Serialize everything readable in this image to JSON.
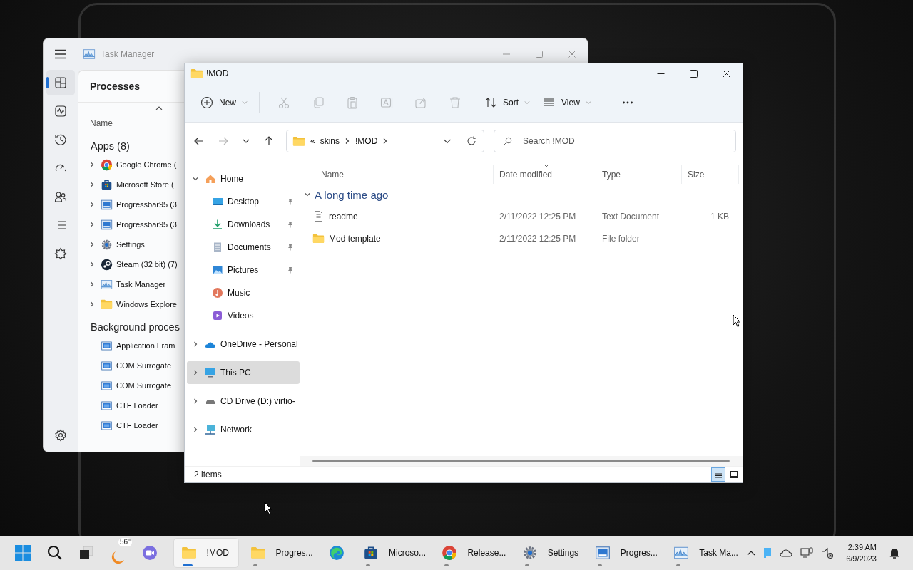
{
  "task_manager": {
    "title": "Task Manager",
    "nav": [
      {
        "selected": true
      },
      {
        "selected": false
      },
      {
        "selected": false
      },
      {
        "selected": false
      },
      {
        "selected": false
      },
      {
        "selected": false
      },
      {
        "selected": false
      }
    ],
    "page_title": "Processes",
    "columns": [
      "Name"
    ],
    "groups": [
      {
        "title": "Apps (8)",
        "items": [
          {
            "name": "Google Chrome (",
            "expandable": true
          },
          {
            "name": "Microsoft Store (",
            "expandable": true
          },
          {
            "name": "Progressbar95 (3",
            "expandable": true
          },
          {
            "name": "Progressbar95 (3",
            "expandable": true
          },
          {
            "name": "Settings",
            "expandable": true
          },
          {
            "name": "Steam (32 bit) (7)",
            "expandable": true
          },
          {
            "name": "Task Manager",
            "expandable": true
          },
          {
            "name": "Windows Explore",
            "expandable": true
          }
        ]
      },
      {
        "title": "Background proces",
        "items": [
          {
            "name": "Application Fram",
            "expandable": false
          },
          {
            "name": "COM Surrogate",
            "expandable": false
          },
          {
            "name": "COM Surrogate",
            "expandable": false
          },
          {
            "name": "CTF Loader",
            "expandable": false
          },
          {
            "name": "CTF Loader",
            "expandable": false
          }
        ]
      }
    ]
  },
  "explorer": {
    "title": "!MOD",
    "toolbar": [
      {
        "label": "New",
        "disabled": false
      },
      {
        "disabled": true
      },
      {
        "disabled": true
      },
      {
        "disabled": true
      },
      {
        "disabled": true
      },
      {
        "disabled": true
      },
      {
        "disabled": true
      },
      {
        "label": "Sort",
        "disabled": false
      },
      {
        "label": "View",
        "disabled": false
      },
      {
        "disabled": false
      }
    ],
    "nav_buttons": [
      {
        "disabled": false
      },
      {
        "disabled": true
      },
      {
        "disabled": false
      },
      {
        "disabled": false
      }
    ],
    "breadcrumb": [
      "«",
      "skins",
      "!MOD"
    ],
    "search": {
      "placeholder": "Search !MOD"
    },
    "nav_tree": [
      {
        "label": "Home",
        "expanded": true,
        "selected": false,
        "children": [
          {
            "label": "Desktop",
            "pinned": true
          },
          {
            "label": "Downloads",
            "pinned": true
          },
          {
            "label": "Documents",
            "pinned": true
          },
          {
            "label": "Pictures",
            "pinned": true
          },
          {
            "label": "Music",
            "pinned": false
          },
          {
            "label": "Videos",
            "pinned": false
          }
        ]
      },
      {
        "label": "OneDrive - Personal",
        "expanded": false,
        "selected": false
      },
      {
        "label": "This PC",
        "expanded": false,
        "selected": true
      },
      {
        "label": "CD Drive (D:) virtio-",
        "expanded": false,
        "selected": false
      },
      {
        "label": "Network",
        "expanded": false,
        "selected": false
      }
    ],
    "columns": [
      {
        "label": "Name",
        "sorted": false
      },
      {
        "label": "Date modified",
        "sorted": true
      },
      {
        "label": "Type",
        "sorted": false
      },
      {
        "label": "Size",
        "sorted": false
      }
    ],
    "groups": [
      {
        "title": "A long time ago",
        "expanded": true,
        "items": [
          {
            "kind": "file",
            "name": "readme",
            "date": "2/11/2022 12:25 PM",
            "type": "Text Document",
            "size": "1 KB"
          },
          {
            "kind": "folder",
            "name": "Mod template",
            "date": "2/11/2022 12:25 PM",
            "type": "File folder"
          }
        ]
      }
    ],
    "status": "2 items",
    "view_modes": [
      {
        "selected": true
      },
      {
        "selected": false
      }
    ]
  },
  "taskbar": {
    "weather": "56°",
    "apps": [
      {
        "label": "!MOD",
        "active": true,
        "running": true
      },
      {
        "label": "Progres...",
        "active": false,
        "running": true
      },
      {
        "active": false,
        "running": false
      },
      {
        "label": "Microso...",
        "active": false,
        "running": true
      },
      {
        "label": "Release...",
        "active": false,
        "running": true
      },
      {
        "label": "Settings",
        "active": false,
        "running": true
      },
      {
        "label": "Progres...",
        "active": false,
        "running": true
      },
      {
        "label": "Task Ma...",
        "active": false,
        "running": true
      }
    ],
    "time": "2:39 AM",
    "date": "6/9/2023"
  }
}
